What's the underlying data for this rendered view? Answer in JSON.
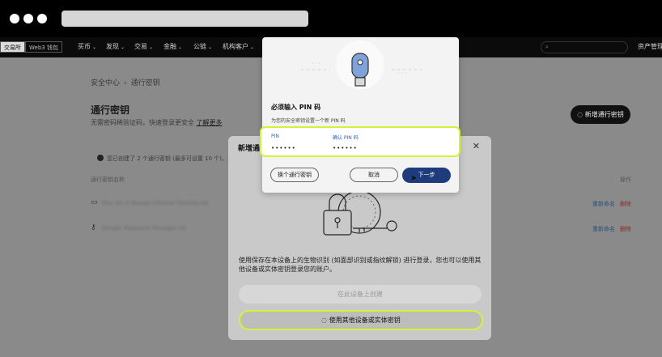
{
  "colors": {
    "accent": "#d4f23a",
    "primary_button": "#1e3c7b",
    "link": "#2860c8"
  },
  "nav": {
    "mode_tabs": [
      "交易所",
      "Web3 钱包"
    ],
    "items": [
      "买币",
      "发现",
      "交易",
      "金融",
      "公链",
      "机构客户"
    ],
    "right_label": "资产管理",
    "search_icon": "search-icon"
  },
  "page": {
    "breadcrumb": [
      "安全中心",
      "通行密钥"
    ],
    "title": "通行密钥",
    "subtitle": "无需密码稀验证码，快速登录更安全",
    "learn_more": "了解更多",
    "add_button": "新增通行密钥",
    "info": "您已创建了 2 个通行密钥 (最多可设置 10 个)，您",
    "table_header": "通行密钥名称",
    "table_op": "操作",
    "rows": [
      {
        "icon": "laptop-icon",
        "name": "Mac OS X Google Chrome Passkey-Xd",
        "rename": "重新命名",
        "delete": "删除"
      },
      {
        "icon": "key-icon",
        "name": "Google Password Manager-Xd",
        "rename": "重新命名",
        "delete": "删除"
      }
    ]
  },
  "modal_new": {
    "title": "新增通",
    "text": "使用保存在本设备上的生物识别 (如面部识别或指纹解锁) 进行登录，您也可以使用其他设备或实体密钥登录您的账户。",
    "btn_create": "在此设备上创建",
    "btn_other": "使用其他设备或实体密钥"
  },
  "modal_pin": {
    "title": "必须输入 PIN 码",
    "subtitle": "为您的安全密钥设置一个新 PIN 码",
    "pin_label": "PIN",
    "confirm_label": "确认 PIN 码",
    "pin_value": "••••••",
    "confirm_value": "••••••",
    "btn_change": "换个通行密钥",
    "btn_cancel": "取消",
    "btn_next": "下一步"
  }
}
